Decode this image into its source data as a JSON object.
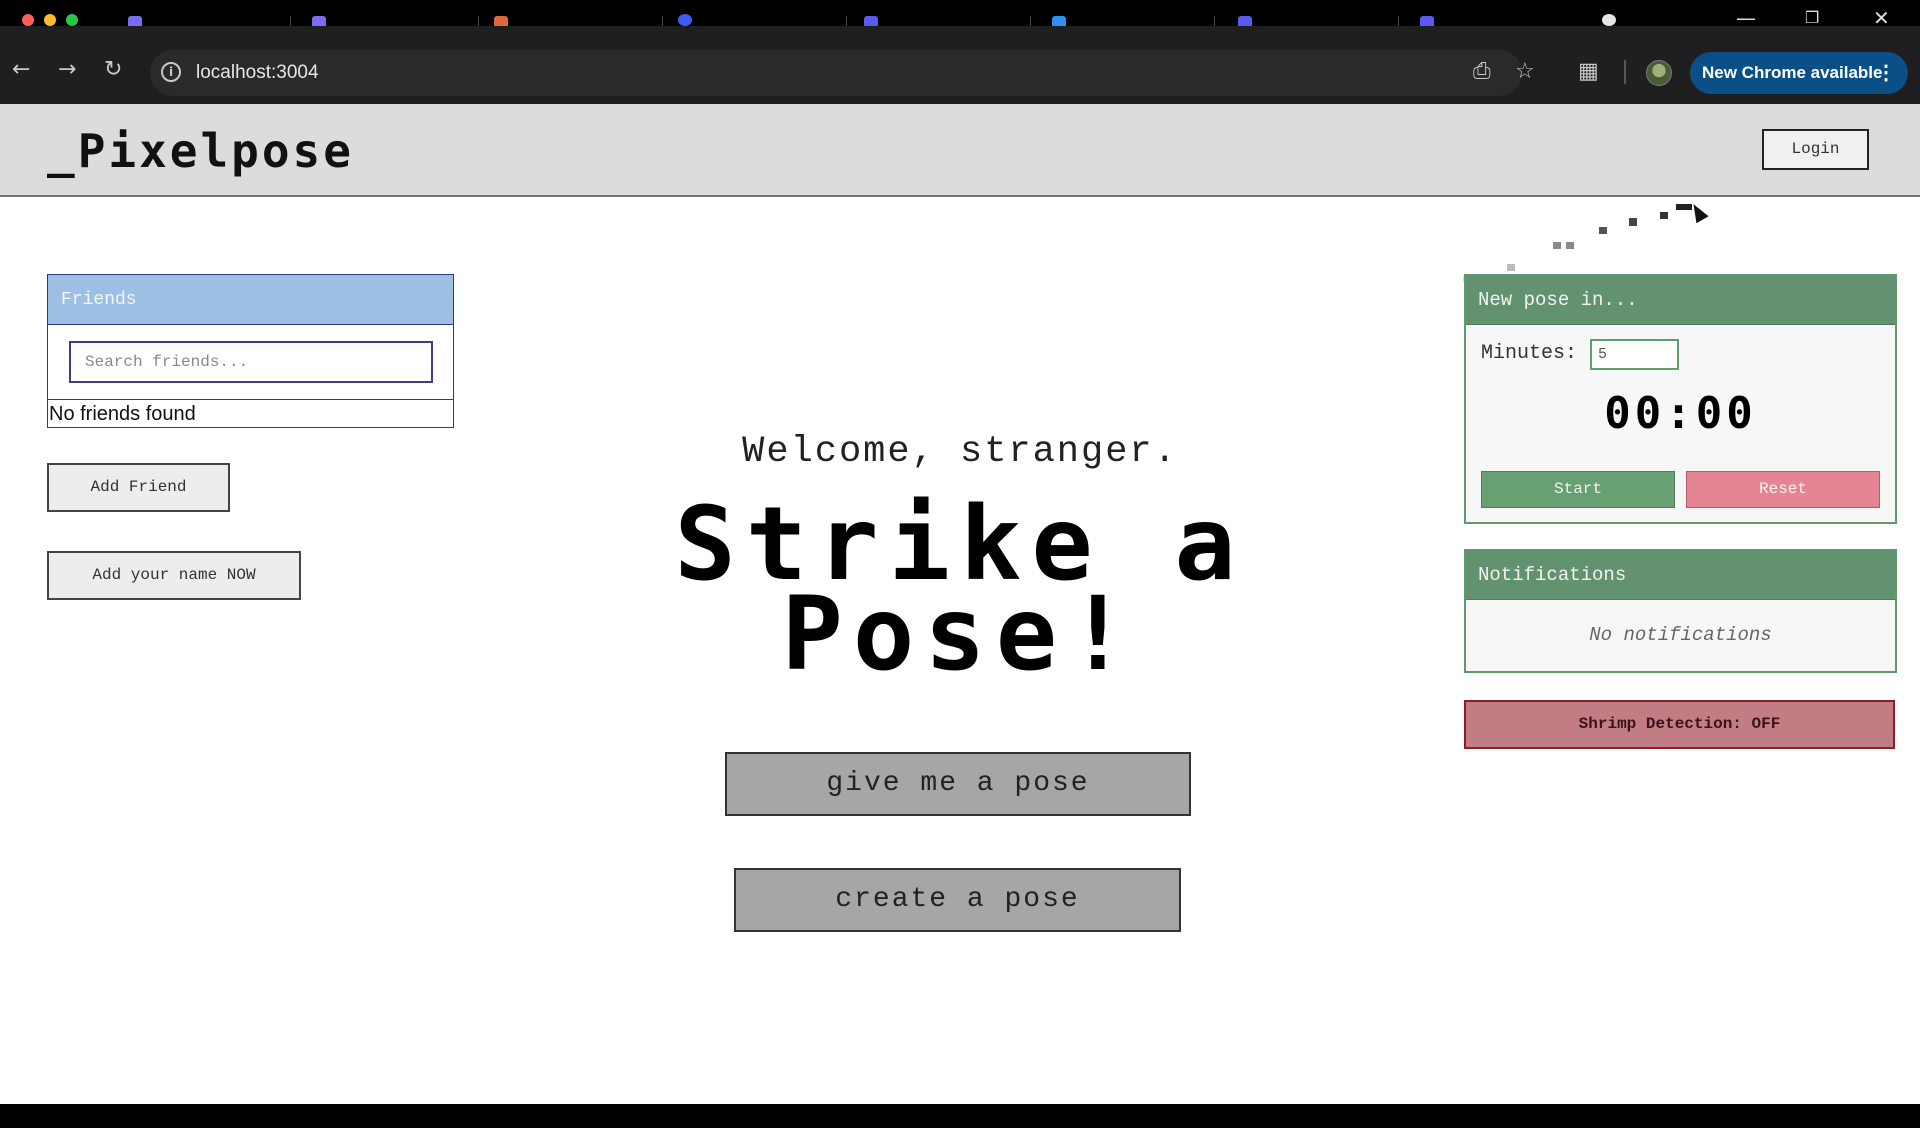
{
  "browser": {
    "url": "localhost:3004",
    "update_button": "New Chrome available"
  },
  "header": {
    "logo": "_Pixelpose",
    "login_label": "Login"
  },
  "friends": {
    "title": "Friends",
    "search_placeholder": "Search friends...",
    "empty_text": "No friends found",
    "add_friend_label": "Add Friend",
    "add_name_label": "Add your name NOW"
  },
  "hero": {
    "welcome": "Welcome, stranger.",
    "headline_line1": "Strike a",
    "headline_line2": "Pose!",
    "give_pose_label": "give me a pose",
    "create_pose_label": "create a pose"
  },
  "timer": {
    "title": "New pose in...",
    "minutes_label": "Minutes:",
    "minutes_value": "5",
    "display": "00:00",
    "start_label": "Start",
    "reset_label": "Reset"
  },
  "notifications": {
    "title": "Notifications",
    "empty_text": "No notifications"
  },
  "shrimp": {
    "label": "Shrimp Detection: OFF"
  },
  "colors": {
    "friends_header": "#9ebfe4",
    "panel_green": "#639270",
    "start_green": "#68a073",
    "reset_pink": "#e58593",
    "shrimp_red": "#c27c84",
    "chrome_update_blue": "#0a4f86"
  }
}
